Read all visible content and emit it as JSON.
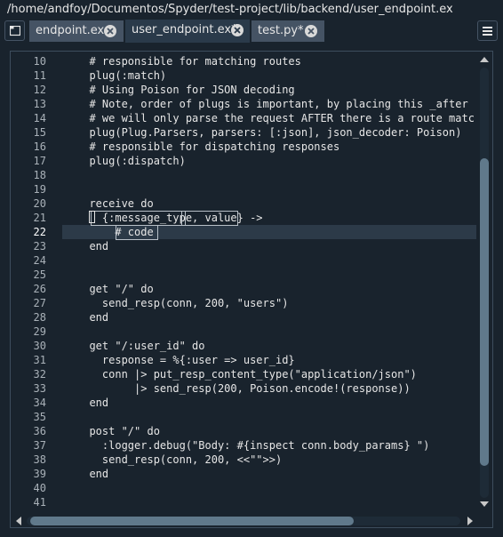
{
  "window": {
    "path": "/home/andfoy/Documentos/Spyder/test-project/lib/backend/user_endpoint.ex"
  },
  "tabs": [
    {
      "label": "endpoint.ex",
      "active": false
    },
    {
      "label": "user_endpoint.ex*",
      "active": true
    },
    {
      "label": "test.py*",
      "active": false
    }
  ],
  "editor": {
    "current_line": "22",
    "lines": [
      {
        "num": "10",
        "text": "  # responsible for matching routes"
      },
      {
        "num": "11",
        "text": "  plug(:match)"
      },
      {
        "num": "12",
        "text": "  # Using Poison for JSON decoding"
      },
      {
        "num": "13",
        "text": "  # Note, order of plugs is important, by placing this _after"
      },
      {
        "num": "14",
        "text": "  # we will only parse the request AFTER there is a route matc"
      },
      {
        "num": "15",
        "text": "  plug(Plug.Parsers, parsers: [:json], json_decoder: Poison)"
      },
      {
        "num": "16",
        "text": "  # responsible for dispatching responses"
      },
      {
        "num": "17",
        "text": "  plug(:dispatch)"
      },
      {
        "num": "18",
        "text": ""
      },
      {
        "num": "19",
        "text": ""
      },
      {
        "num": "20",
        "text": "  receive do"
      },
      {
        "num": "21",
        "text": "    {:message_type, value} ->"
      },
      {
        "num": "22",
        "text": "      # code"
      },
      {
        "num": "23",
        "text": "  end"
      },
      {
        "num": "24",
        "text": ""
      },
      {
        "num": "25",
        "text": ""
      },
      {
        "num": "26",
        "text": "  get \"/\" do"
      },
      {
        "num": "27",
        "text": "    send_resp(conn, 200, \"users\")"
      },
      {
        "num": "28",
        "text": "  end"
      },
      {
        "num": "29",
        "text": ""
      },
      {
        "num": "30",
        "text": "  get \"/:user_id\" do"
      },
      {
        "num": "31",
        "text": "    response = %{:user => user_id}"
      },
      {
        "num": "32",
        "text": "    conn |> put_resp_content_type(\"application/json\")"
      },
      {
        "num": "33",
        "text": "         |> send_resp(200, Poison.encode!(response))"
      },
      {
        "num": "34",
        "text": "  end"
      },
      {
        "num": "35",
        "text": ""
      },
      {
        "num": "36",
        "text": "  post \"/\" do"
      },
      {
        "num": "37",
        "text": "    :logger.debug(\"Body: #{inspect conn.body_params} \")"
      },
      {
        "num": "38",
        "text": "    send_resp(conn, 200, <<\"\">>)"
      },
      {
        "num": "39",
        "text": "  end"
      },
      {
        "num": "40",
        "text": ""
      },
      {
        "num": "41",
        "text": ""
      }
    ]
  },
  "icons": {
    "browse": "browse-tabs-icon",
    "close": "close-icon",
    "menu": "hamburger-menu-icon"
  },
  "colors": {
    "background": "#19232d",
    "tab_inactive": "#455364",
    "current_line": "#2c3a48",
    "scroll_thumb": "#60798b"
  }
}
